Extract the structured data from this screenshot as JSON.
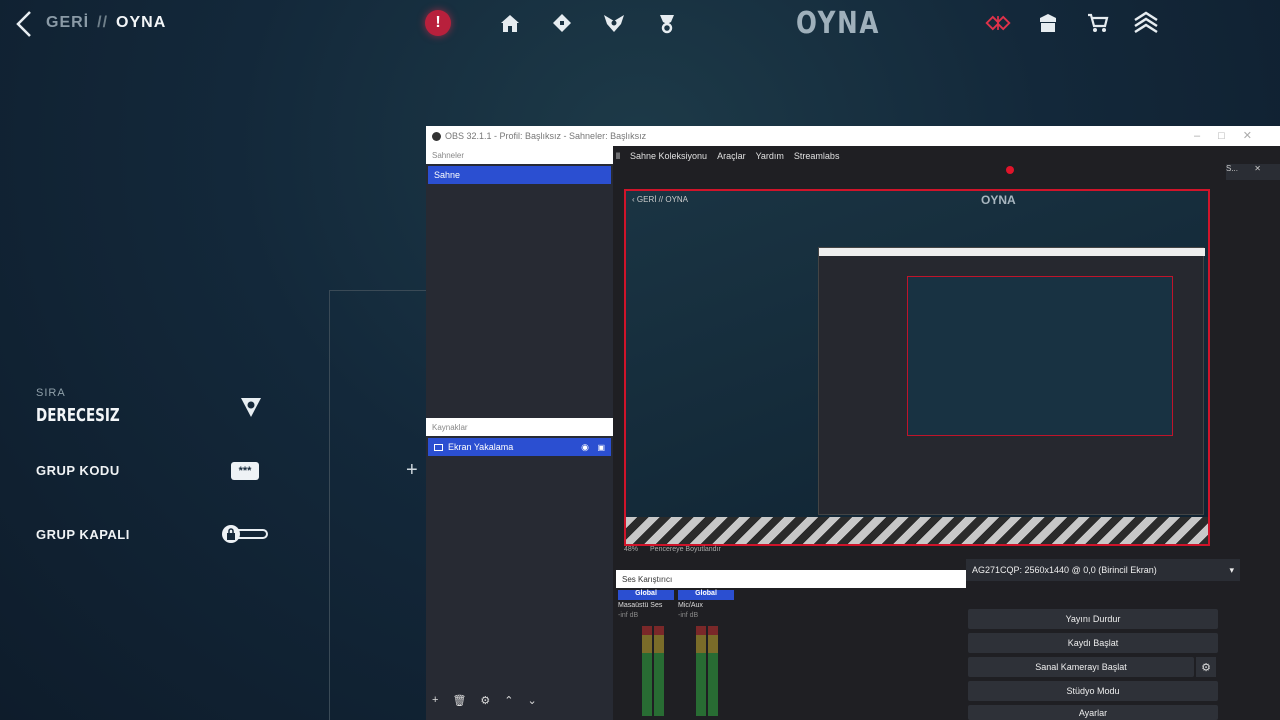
{
  "nav": {
    "back_label": "GERİ",
    "separator": "//",
    "current": "OYNA",
    "title": "OYNA",
    "alert_glyph": "!",
    "icons": [
      "home-icon",
      "collection-icon",
      "agents-icon",
      "career-icon",
      "battlepass-icon",
      "locker-icon",
      "store-icon",
      "rank-icon"
    ]
  },
  "left": {
    "sira_label": "SIRA",
    "sira_value": "DERECESIZ",
    "group_code_label": "GRUP KODU",
    "group_closed_label": "GRUP KAPALI",
    "code_glyph": "***"
  },
  "obs": {
    "window_title": "OBS 32.1.1 - Profil: Başlıksız - Sahneler: Başlıksız",
    "menu": [
      "ll",
      "Sahne Koleksiyonu",
      "Araçlar",
      "Yardım",
      "Streamlabs"
    ],
    "scenes_header": "Sahneler",
    "scene_item": "Sahne",
    "sources_header": "Kaynaklar",
    "source_item": "Ekran Yakalama",
    "zoom": "48%",
    "fit_label": "Pencereye Boyutlandır",
    "mixer_header": "Ses Karıştırıcı",
    "channels": [
      {
        "scope": "Global",
        "name": "Masaüstü Ses",
        "db": "-inf dB"
      },
      {
        "scope": "Global",
        "name": "Mic/Aux",
        "db": "-inf dB"
      }
    ],
    "display": "AG271CQP: 2560x1440 @ 0,0 (Birincil Ekran)",
    "buttons": [
      "Yayını Durdur",
      "Kaydı Başlat",
      "Sanal Kamerayı Başlat",
      "Stüdyo Modu",
      "Ayarlar"
    ],
    "right_dock_label": "S..."
  }
}
